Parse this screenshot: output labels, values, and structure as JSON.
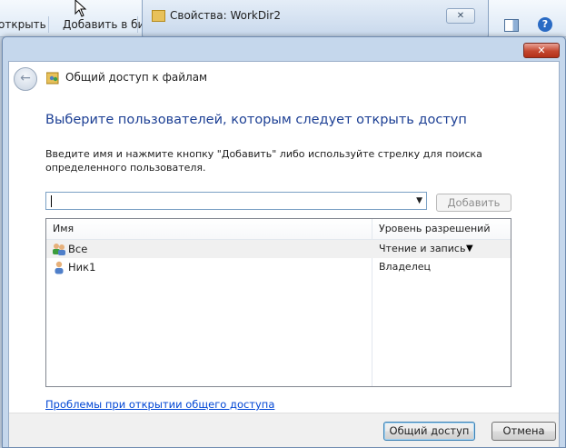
{
  "background": {
    "toolbar_left_text": "открыть",
    "toolbar_add_text": "Добавить в библ",
    "properties_window_title": "Свойства: WorkDir2"
  },
  "dialog": {
    "close_glyph": "✕",
    "nav_title": "Общий доступ к файлам",
    "heading": "Выберите пользователей, которым следует открыть доступ",
    "instructions": "Введите имя и нажмите кнопку \"Добавить\" либо используйте стрелку для поиска определенного пользователя.",
    "input": {
      "value": "",
      "placeholder": ""
    },
    "add_button": "Добавить",
    "columns": [
      "Имя",
      "Уровень разрешений"
    ],
    "rows": [
      {
        "name": "Все",
        "permission": "Чтение и запись",
        "icon": "users-group-icon",
        "selected": true
      },
      {
        "name": "Ник1",
        "permission": "Владелец",
        "icon": "user-icon",
        "selected": false
      }
    ],
    "link": "Проблемы при открытии общего доступа",
    "share_button": "Общий доступ",
    "cancel_button": "Отмена"
  },
  "colors": {
    "heading": "#1c3f94",
    "link": "#0046d5",
    "close_red": "#c4472f"
  }
}
